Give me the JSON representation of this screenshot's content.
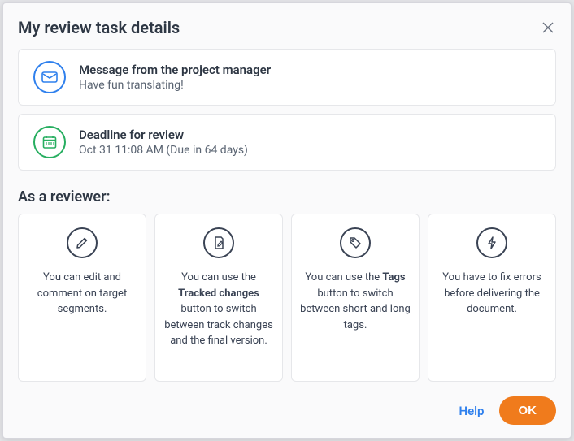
{
  "dialog": {
    "title": "My review task details"
  },
  "message": {
    "title": "Message from the project manager",
    "body": "Have fun translating!"
  },
  "deadline": {
    "title": "Deadline for review",
    "body": "Oct 31 11:08 AM (Due in 64 days)"
  },
  "section": {
    "reviewer_label": "As a reviewer:"
  },
  "tips": {
    "edit": {
      "text": "You can edit and comment on target segments."
    },
    "tracked": {
      "pre": "You can use the ",
      "bold": "Tracked changes",
      "post": " button to switch between track changes and the final version."
    },
    "tags": {
      "pre": "You can use the ",
      "bold": "Tags",
      "post": " button to switch between short and long tags."
    },
    "fix": {
      "text": "You have to fix errors before delivering the document."
    }
  },
  "footer": {
    "help": "Help",
    "ok": "OK"
  }
}
